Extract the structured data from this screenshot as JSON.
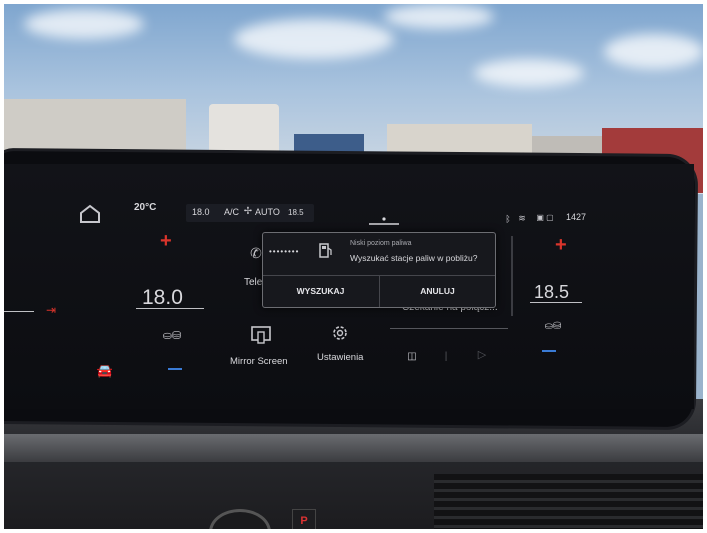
{
  "status_bar": {
    "outside_temp": "20°C",
    "left_temp_set": "18.0",
    "ac_label": "A/C",
    "fan_mode": "AUTO",
    "right_temp_set": "18.5",
    "clock": "1427"
  },
  "climate": {
    "left_temp": "18.0",
    "right_temp": "18.5"
  },
  "apps": {
    "telephone_partial": "Tele",
    "mirror_screen": "Mirror Screen",
    "settings": "Ustawienia",
    "media_status": "Czekanie na połącz..."
  },
  "popup": {
    "title": "Niski poziom paliwa",
    "message": "Wyszukać stacje paliw w pobliżu?",
    "search_button": "WYSZUKAJ",
    "cancel_button": "ANULUJ",
    "gauge_dots": "••••••••"
  },
  "icons": {
    "home": "home-icon",
    "car": "car-icon",
    "seat_left": "seat-heating-icon",
    "seat_right": "seat-heating-icon",
    "exit_side": "exit-icon",
    "bluetooth": "bluetooth-icon",
    "wifi": "wifi-icon",
    "phone": "phone-icon",
    "fuel": "fuel-pump-icon",
    "mirror": "mirror-screen-icon",
    "settings": "gear-icon",
    "media_source": "media-source-icon",
    "play": "play-icon"
  },
  "colors": {
    "accent_red": "#d9342b",
    "accent_blue": "#3a7bd5",
    "screen_bg": "#0c0d11"
  }
}
